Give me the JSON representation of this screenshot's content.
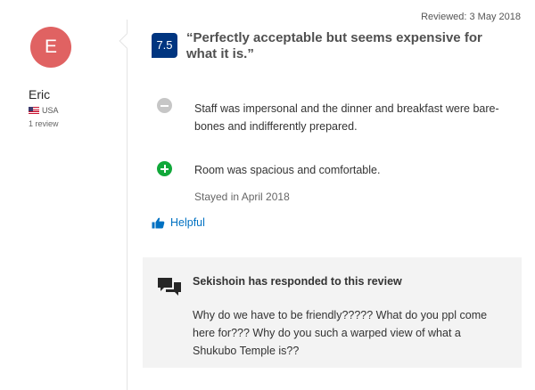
{
  "reviewer": {
    "initial": "E",
    "name": "Eric",
    "country": "USA",
    "review_count": "1 review"
  },
  "review": {
    "reviewed_date": "Reviewed: 3 May 2018",
    "score": "7.5",
    "title": "“Perfectly acceptable but seems expensive for what it is.”",
    "negative": "Staff was impersonal and the dinner and breakfast were bare-bones and indifferently prepared.",
    "positive": "Room was spacious and comfortable.",
    "stayed": "Stayed in April 2018",
    "helpful_label": "Helpful"
  },
  "response": {
    "heading": "Sekishoin has responded to this review",
    "text": "Why do we have to be friendly????? What do you ppl come here for??? Why do you such a warped view of what a Shukubo Temple is??"
  },
  "colors": {
    "avatar": "#e06262",
    "score_badge": "#003580",
    "positive": "#11a83a",
    "negative": "#c6c6c6",
    "link": "#0071c2"
  }
}
